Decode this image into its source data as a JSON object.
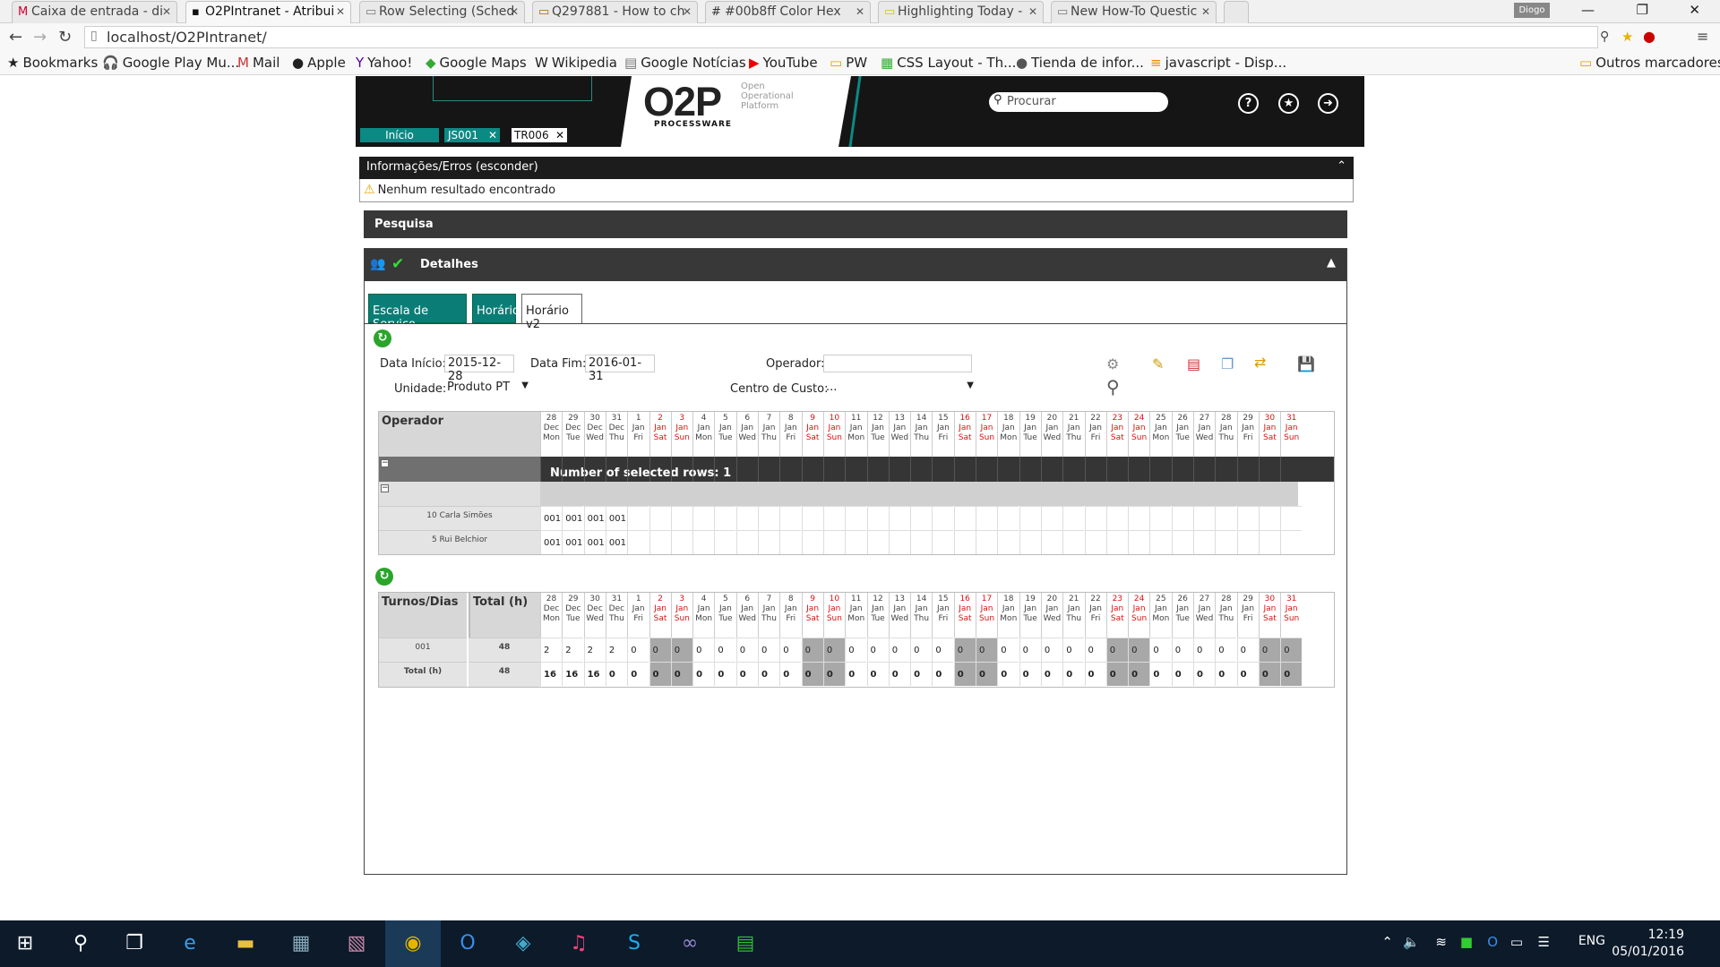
{
  "browser": {
    "tabs": [
      {
        "title": "Caixa de entrada - di",
        "favicon": "gmail-icon"
      },
      {
        "title": "O2PIntranet - Atribui",
        "favicon": "o2p-icon"
      },
      {
        "title": "Row Selecting (Sched",
        "favicon": "page-icon"
      },
      {
        "title": "Q297881 - How to ch",
        "favicon": "page-icon"
      },
      {
        "title": "#00b8ff Color Hex",
        "favicon": "page-icon"
      },
      {
        "title": "Highlighting Today -",
        "favicon": "page-icon"
      },
      {
        "title": "New How-To Questic",
        "favicon": "page-icon"
      }
    ],
    "profile": "Diogo",
    "url": "localhost/O2PIntranet/",
    "bookmarks": [
      {
        "label": "Bookmarks",
        "icon": "star-icon"
      },
      {
        "label": "Google Play Mu...",
        "icon": "headphones-icon"
      },
      {
        "label": "Mail",
        "icon": "gmail-icon"
      },
      {
        "label": "Apple",
        "icon": "apple-icon"
      },
      {
        "label": "Yahoo!",
        "icon": "yahoo-icon"
      },
      {
        "label": "Google Maps",
        "icon": "maps-icon"
      },
      {
        "label": "Wikipedia",
        "icon": "wikipedia-icon"
      },
      {
        "label": "Google Notícias",
        "icon": "news-icon"
      },
      {
        "label": "YouTube",
        "icon": "youtube-icon"
      },
      {
        "label": "PW",
        "icon": "folder-icon"
      },
      {
        "label": "CSS Layout - Th...",
        "icon": "css-icon"
      },
      {
        "label": "Tienda de infor...",
        "icon": "store-icon"
      },
      {
        "label": "javascript - Disp...",
        "icon": "so-icon"
      }
    ],
    "other_bookmarks": "Outros marcadores"
  },
  "app": {
    "logo": "O2P",
    "logo_sub": "PROCESSWARE",
    "logo_tag": "Open Operational Platform",
    "search_placeholder": "Procurar",
    "tabs": [
      {
        "label": "Início",
        "closable": false
      },
      {
        "label": "JS001",
        "closable": true
      },
      {
        "label": "TR006",
        "closable": true
      }
    ],
    "header_icons": [
      "help-icon",
      "favorites-icon",
      "logout-icon"
    ]
  },
  "info": {
    "bar_title": "Informações/Erros (esconder)",
    "message": "Nenhum resultado encontrado"
  },
  "pesquisa": "Pesquisa",
  "detalhes": {
    "title": "Detalhes",
    "subtabs": [
      "Escala de Serviço",
      "Horário",
      "Horário v2"
    ],
    "form": {
      "data_inicio_label": "Data Início:",
      "data_inicio": "2015-12-28",
      "data_fim_label": "Data Fim:",
      "data_fim": "2016-01-31",
      "operador_label": "Operador:",
      "operador": "",
      "unidade_label": "Unidade:",
      "unidade": "Produto PT",
      "centro_label": "Centro de Custo:",
      "centro": "..."
    }
  },
  "days": [
    {
      "d": "28",
      "m": "Dec",
      "w": "Mon",
      "we": false
    },
    {
      "d": "29",
      "m": "Dec",
      "w": "Tue",
      "we": false
    },
    {
      "d": "30",
      "m": "Dec",
      "w": "Wed",
      "we": false
    },
    {
      "d": "31",
      "m": "Dec",
      "w": "Thu",
      "we": false
    },
    {
      "d": "1",
      "m": "Jan",
      "w": "Fri",
      "we": false
    },
    {
      "d": "2",
      "m": "Jan",
      "w": "Sat",
      "we": true
    },
    {
      "d": "3",
      "m": "Jan",
      "w": "Sun",
      "we": true
    },
    {
      "d": "4",
      "m": "Jan",
      "w": "Mon",
      "we": false
    },
    {
      "d": "5",
      "m": "Jan",
      "w": "Tue",
      "we": false
    },
    {
      "d": "6",
      "m": "Jan",
      "w": "Wed",
      "we": false
    },
    {
      "d": "7",
      "m": "Jan",
      "w": "Thu",
      "we": false
    },
    {
      "d": "8",
      "m": "Jan",
      "w": "Fri",
      "we": false
    },
    {
      "d": "9",
      "m": "Jan",
      "w": "Sat",
      "we": true
    },
    {
      "d": "10",
      "m": "Jan",
      "w": "Sun",
      "we": true
    },
    {
      "d": "11",
      "m": "Jan",
      "w": "Mon",
      "we": false
    },
    {
      "d": "12",
      "m": "Jan",
      "w": "Tue",
      "we": false
    },
    {
      "d": "13",
      "m": "Jan",
      "w": "Wed",
      "we": false
    },
    {
      "d": "14",
      "m": "Jan",
      "w": "Thu",
      "we": false
    },
    {
      "d": "15",
      "m": "Jan",
      "w": "Fri",
      "we": false
    },
    {
      "d": "16",
      "m": "Jan",
      "w": "Sat",
      "we": true
    },
    {
      "d": "17",
      "m": "Jan",
      "w": "Sun",
      "we": true
    },
    {
      "d": "18",
      "m": "Jan",
      "w": "Mon",
      "we": false
    },
    {
      "d": "19",
      "m": "Jan",
      "w": "Tue",
      "we": false
    },
    {
      "d": "20",
      "m": "Jan",
      "w": "Wed",
      "we": false
    },
    {
      "d": "21",
      "m": "Jan",
      "w": "Thu",
      "we": false
    },
    {
      "d": "22",
      "m": "Jan",
      "w": "Fri",
      "we": false
    },
    {
      "d": "23",
      "m": "Jan",
      "w": "Sat",
      "we": true
    },
    {
      "d": "24",
      "m": "Jan",
      "w": "Sun",
      "we": true
    },
    {
      "d": "25",
      "m": "Jan",
      "w": "Mon",
      "we": false
    },
    {
      "d": "26",
      "m": "Jan",
      "w": "Tue",
      "we": false
    },
    {
      "d": "27",
      "m": "Jan",
      "w": "Wed",
      "we": false
    },
    {
      "d": "28",
      "m": "Jan",
      "w": "Thu",
      "we": false
    },
    {
      "d": "29",
      "m": "Jan",
      "w": "Fri",
      "we": false
    },
    {
      "d": "30",
      "m": "Jan",
      "w": "Sat",
      "we": true
    },
    {
      "d": "31",
      "m": "Jan",
      "w": "Sun",
      "we": true
    }
  ],
  "schedule": {
    "header": "Operador",
    "selected_text": "Number of selected rows: 1",
    "rows": [
      {
        "name": "10 Carla Simões",
        "values": [
          "001",
          "001",
          "001",
          "001"
        ]
      },
      {
        "name": "5 Rui Belchior",
        "values": [
          "001",
          "001",
          "001",
          "001"
        ]
      }
    ]
  },
  "summary": {
    "header_turnos": "Turnos/Dias",
    "header_total": "Total (h)",
    "rows": [
      {
        "label": "001",
        "total": "48",
        "values": [
          "2",
          "2",
          "2",
          "2",
          "0",
          "0",
          "0",
          "0",
          "0",
          "0",
          "0",
          "0",
          "0",
          "0",
          "0",
          "0",
          "0",
          "0",
          "0",
          "0",
          "0",
          "0",
          "0",
          "0",
          "0",
          "0",
          "0",
          "0",
          "0",
          "0",
          "0",
          "0",
          "0",
          "0",
          "0"
        ]
      },
      {
        "label": "Total (h)",
        "total": "48",
        "values": [
          "16",
          "16",
          "16",
          "0",
          "0",
          "0",
          "0",
          "0",
          "0",
          "0",
          "0",
          "0",
          "0",
          "0",
          "0",
          "0",
          "0",
          "0",
          "0",
          "0",
          "0",
          "0",
          "0",
          "0",
          "0",
          "0",
          "0",
          "0",
          "0",
          "0",
          "0",
          "0",
          "0",
          "0",
          "0"
        ]
      }
    ]
  },
  "taskbar": {
    "apps": [
      "windows-start-icon",
      "search-icon",
      "task-view-icon",
      "ie-icon",
      "explorer-icon",
      "network-app-icon",
      "vs-icon",
      "chrome-icon",
      "outlook-icon",
      "network-icon",
      "itunes-icon",
      "skype-icon",
      "vs-infinity-icon",
      "excel-icon"
    ],
    "lang": "ENG",
    "time": "12:19",
    "date": "05/01/2016"
  }
}
